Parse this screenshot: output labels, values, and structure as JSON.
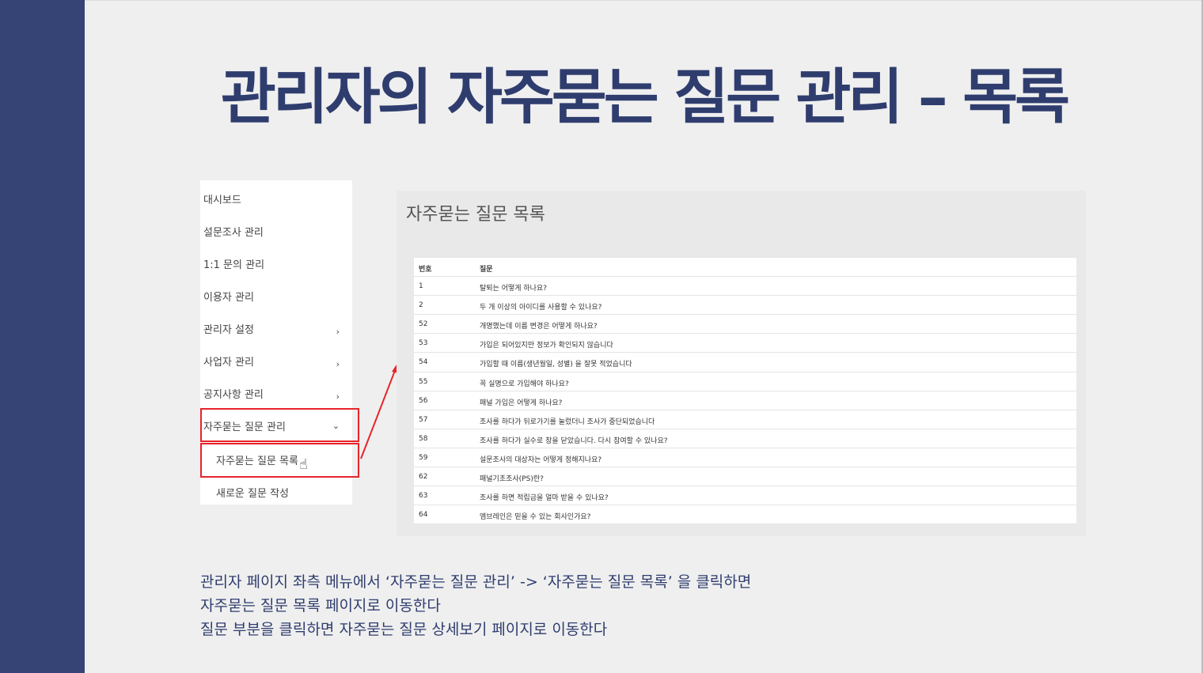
{
  "title": "관리자의 자주묻는 질문 관리 – 목록",
  "sidebar": {
    "items": [
      {
        "label": "대시보드",
        "chevron": ""
      },
      {
        "label": "설문조사 관리",
        "chevron": ""
      },
      {
        "label": "1:1 문의 관리",
        "chevron": ""
      },
      {
        "label": "이용자 관리",
        "chevron": ""
      },
      {
        "label": "관리자 설정",
        "chevron": "›"
      },
      {
        "label": "사업자 관리",
        "chevron": "›"
      },
      {
        "label": "공지사항 관리",
        "chevron": "›"
      },
      {
        "label": "자주묻는 질문 관리",
        "chevron": "⌄"
      }
    ],
    "subitems": [
      {
        "label": "자주묻는 질문 목록"
      },
      {
        "label": "새로운 질문 작성"
      }
    ]
  },
  "panel": {
    "title": "자주묻는 질문 목록",
    "table": {
      "headers": [
        "번호",
        "질문"
      ],
      "rows": [
        [
          "1",
          "탈퇴는 어떻게 하나요?"
        ],
        [
          "2",
          "두 개 이상의 아이디를 사용할 수 있나요?"
        ],
        [
          "52",
          "개명했는데 이름 변경은 어떻게 하나요?"
        ],
        [
          "53",
          "가입은 되어있지만 정보가 확인되지 않습니다"
        ],
        [
          "54",
          "가입할 때 이름(생년월일, 성별) 을 잘못 적었습니다"
        ],
        [
          "55",
          "꼭 실명으로 가입해야 하나요?"
        ],
        [
          "56",
          "패널 가입은 어떻게 하나요?"
        ],
        [
          "57",
          "조사를 하다가 뒤로가기를 눌렀더니 조사가 중단되었습니다"
        ],
        [
          "58",
          "조사를 하다가 실수로 창을 닫았습니다. 다시 참여할 수 있나요?"
        ],
        [
          "59",
          "설문조사의 대상자는 어떻게 정해지나요?"
        ],
        [
          "62",
          "패널기초조사(PS)란?"
        ],
        [
          "63",
          "조사를 하면 적립금을 얼마 받을 수 있나요?"
        ],
        [
          "64",
          "엠브레인은 믿을 수 있는 회사인가요?"
        ]
      ]
    }
  },
  "description": {
    "line1": "관리자 페이지 좌측 메뉴에서 ‘자주묻는 질문 관리’ -> ‘자주묻는 질문 목록’ 을 클릭하면",
    "line2": "자주묻는 질문 목록 페이지로 이동한다",
    "line3": "질문 부분을 클릭하면 자주묻는 질문 상세보기 페이지로 이동한다"
  },
  "colors": {
    "band": "#354474",
    "title": "#2f3d6e",
    "highlight": "#e8242a"
  }
}
